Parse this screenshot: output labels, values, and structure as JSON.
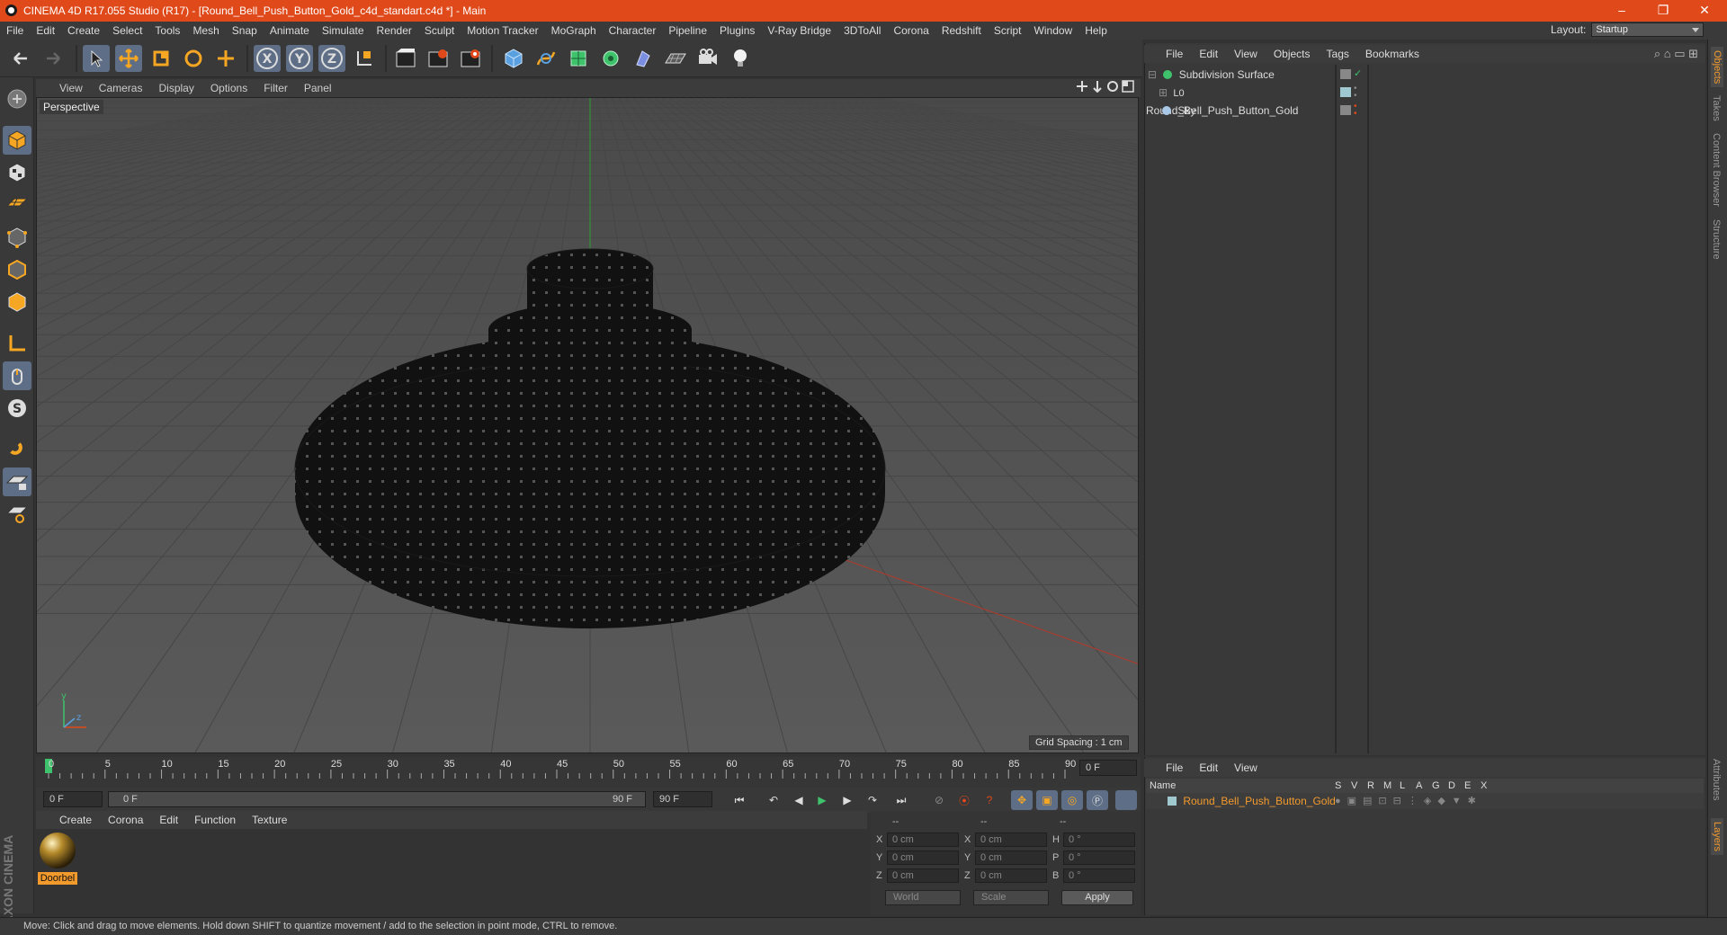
{
  "window": {
    "title": "CINEMA 4D R17.055 Studio (R17) - [Round_Bell_Push_Button_Gold_c4d_standart.c4d *] - Main",
    "controls": {
      "minimize": "–",
      "restore": "❐",
      "close": "✕"
    }
  },
  "menubar": [
    "File",
    "Edit",
    "Create",
    "Select",
    "Tools",
    "Mesh",
    "Snap",
    "Animate",
    "Simulate",
    "Render",
    "Sculpt",
    "Motion Tracker",
    "MoGraph",
    "Character",
    "Pipeline",
    "Plugins",
    "V-Ray Bridge",
    "3DToAll",
    "Corona",
    "Redshift",
    "Script",
    "Window",
    "Help"
  ],
  "layout": {
    "label": "Layout:",
    "value": "Startup"
  },
  "toolbar": {
    "undo": "undo-icon",
    "redo": "redo-icon",
    "axis_x": "X",
    "axis_y": "Y",
    "axis_z": "Z"
  },
  "viewport": {
    "menu": [
      "View",
      "Cameras",
      "Display",
      "Options",
      "Filter",
      "Panel"
    ],
    "label": "Perspective",
    "grid_spacing": "Grid Spacing : 1 cm"
  },
  "timeline": {
    "ticks": [
      "0",
      "5",
      "10",
      "15",
      "20",
      "25",
      "30",
      "35",
      "40",
      "45",
      "50",
      "55",
      "60",
      "65",
      "70",
      "75",
      "80",
      "85",
      "90"
    ],
    "current_frame": "0 F"
  },
  "transport": {
    "start": "0 F",
    "range_start": "0 F",
    "range_end": "90 F",
    "end": "90 F"
  },
  "material_panel": {
    "menu": [
      "Create",
      "Corona",
      "Edit",
      "Function",
      "Texture"
    ],
    "material_name": "Doorbel"
  },
  "coordinates": {
    "header": [
      "--",
      "--",
      "--"
    ],
    "rows": [
      {
        "a": "X",
        "a_val": "0 cm",
        "b": "X",
        "b_val": "0 cm",
        "c": "H",
        "c_val": "0 °"
      },
      {
        "a": "Y",
        "a_val": "0 cm",
        "b": "Y",
        "b_val": "0 cm",
        "c": "P",
        "c_val": "0 °"
      },
      {
        "a": "Z",
        "a_val": "0 cm",
        "b": "Z",
        "b_val": "0 cm",
        "c": "B",
        "c_val": "0 °"
      }
    ],
    "space": "World",
    "mode": "Scale",
    "apply": "Apply"
  },
  "object_manager": {
    "menu": [
      "File",
      "Edit",
      "View",
      "Objects",
      "Tags",
      "Bookmarks"
    ],
    "objects": [
      {
        "name": "Subdivision Surface",
        "indent": 0
      },
      {
        "name": "Round_Bell_Push_Button_Gold",
        "indent": 1
      },
      {
        "name": "Sky",
        "indent": 0
      }
    ]
  },
  "layer_manager": {
    "menu": [
      "File",
      "Edit",
      "View"
    ],
    "columns": [
      "Name",
      "S",
      "V",
      "R",
      "M",
      "L",
      "A",
      "G",
      "D",
      "E",
      "X"
    ],
    "layers": [
      {
        "name": "Round_Bell_Push_Button_Gold"
      }
    ]
  },
  "side_tabs": [
    "Objects",
    "Takes",
    "Content Browser",
    "Structure"
  ],
  "side_tabs_lower": [
    "Attributes",
    "Layers"
  ],
  "branding": "MAXON CINEMA 4D",
  "status": "Move: Click and drag to move elements. Hold down SHIFT to quantize movement / add to the selection in point mode, CTRL to remove.",
  "colors": {
    "title_bar": "#e04a1b",
    "accent": "#f39a2c",
    "active_tool": "#5e6e86"
  }
}
